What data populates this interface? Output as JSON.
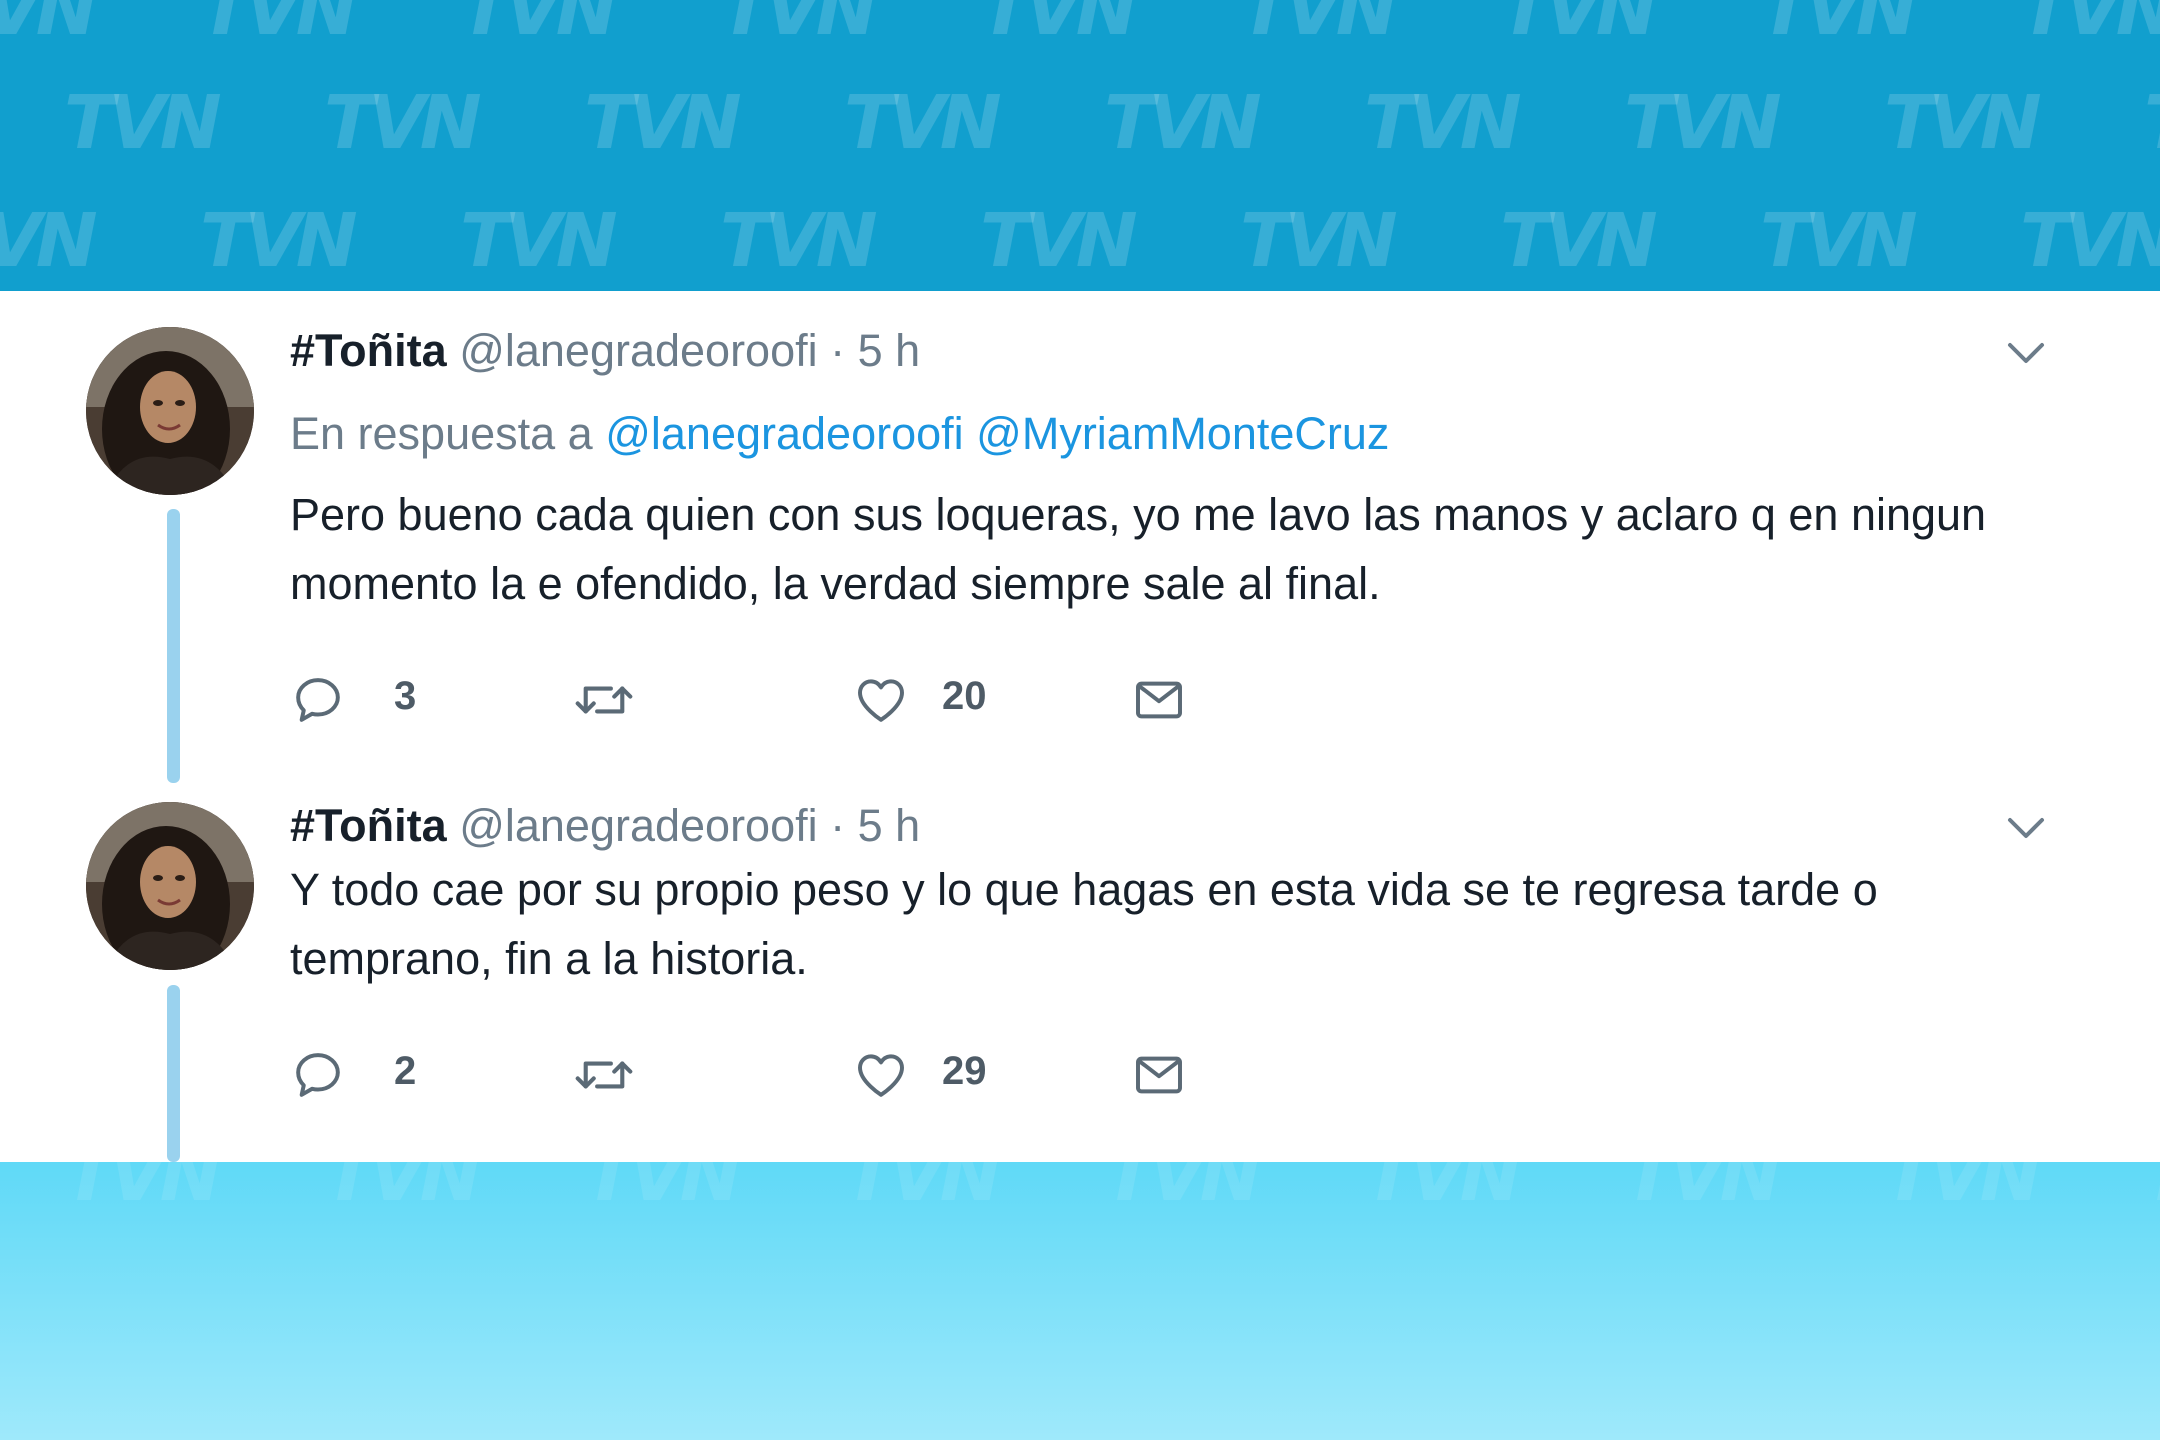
{
  "banner": {
    "watermark": "TVN"
  },
  "tweets": [
    {
      "display_name": "#Toñita",
      "handle": "@lanegradeoroofi",
      "time": "· 5 h",
      "reply_prefix": "En respuesta a",
      "reply_mentions": [
        "@lanegradeoroofi",
        "@MyriamMonteCruz"
      ],
      "text": "Pero bueno cada quien con sus loqueras,  yo me lavo las manos y aclaro q en ningun momento la e ofendido,  la verdad siempre sale al final.",
      "replies": "3",
      "likes": "20"
    },
    {
      "display_name": "#Toñita",
      "handle": "@lanegradeoroofi",
      "time": "· 5 h",
      "text": "Y todo cae por su propio peso y lo que hagas en esta vida se te regresa tarde o temprano,  fin a la historia.",
      "replies": "2",
      "likes": "29"
    }
  ],
  "colors": {
    "banner_top": "#119fce",
    "banner_bottom": "#5fd9f7",
    "mention": "#1b95e0",
    "thread_line": "#9ad2ee",
    "text": "#17202a",
    "muted": "#6c7c8a"
  }
}
